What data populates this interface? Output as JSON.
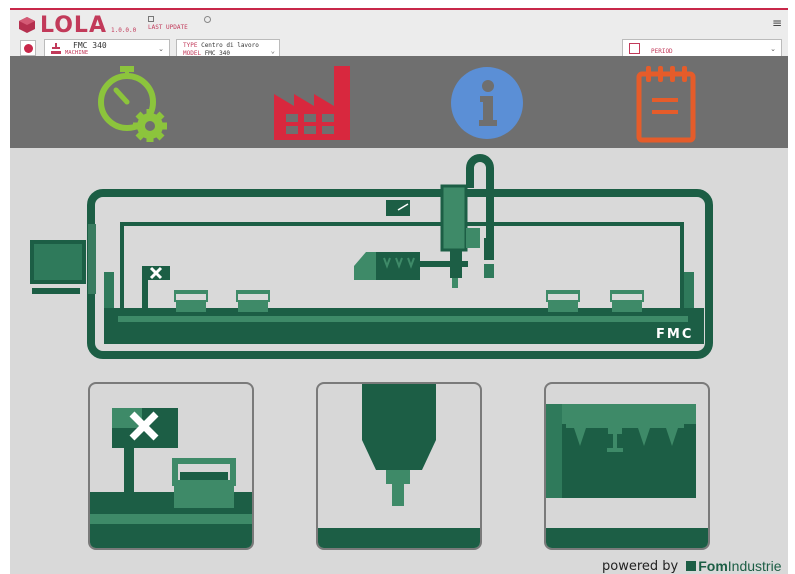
{
  "app": {
    "name": "LOLA",
    "version": "1.0.0.0"
  },
  "header": {
    "last_update_label": "LAST UPDATE",
    "machine": {
      "value": "FMC 340",
      "label": "MACHINE"
    },
    "type": {
      "key": "TYPE",
      "value": "Centro di lavoro"
    },
    "model": {
      "key": "MODEL",
      "value": "FMC 340"
    },
    "period": {
      "label": "PERIOD"
    }
  },
  "nav_icons": [
    {
      "name": "stopwatch-gear-icon",
      "color": "#8cc43c"
    },
    {
      "name": "factory-icon",
      "color": "#d8283e"
    },
    {
      "name": "info-icon",
      "color": "#5b8fd6"
    },
    {
      "name": "notepad-icon",
      "color": "#e55c2a"
    }
  ],
  "machine": {
    "badge": "FMC",
    "color": "#1c5e45"
  },
  "footer": {
    "powered_by": "powered by",
    "brand_a": "Fom",
    "brand_b": "Industrie"
  }
}
